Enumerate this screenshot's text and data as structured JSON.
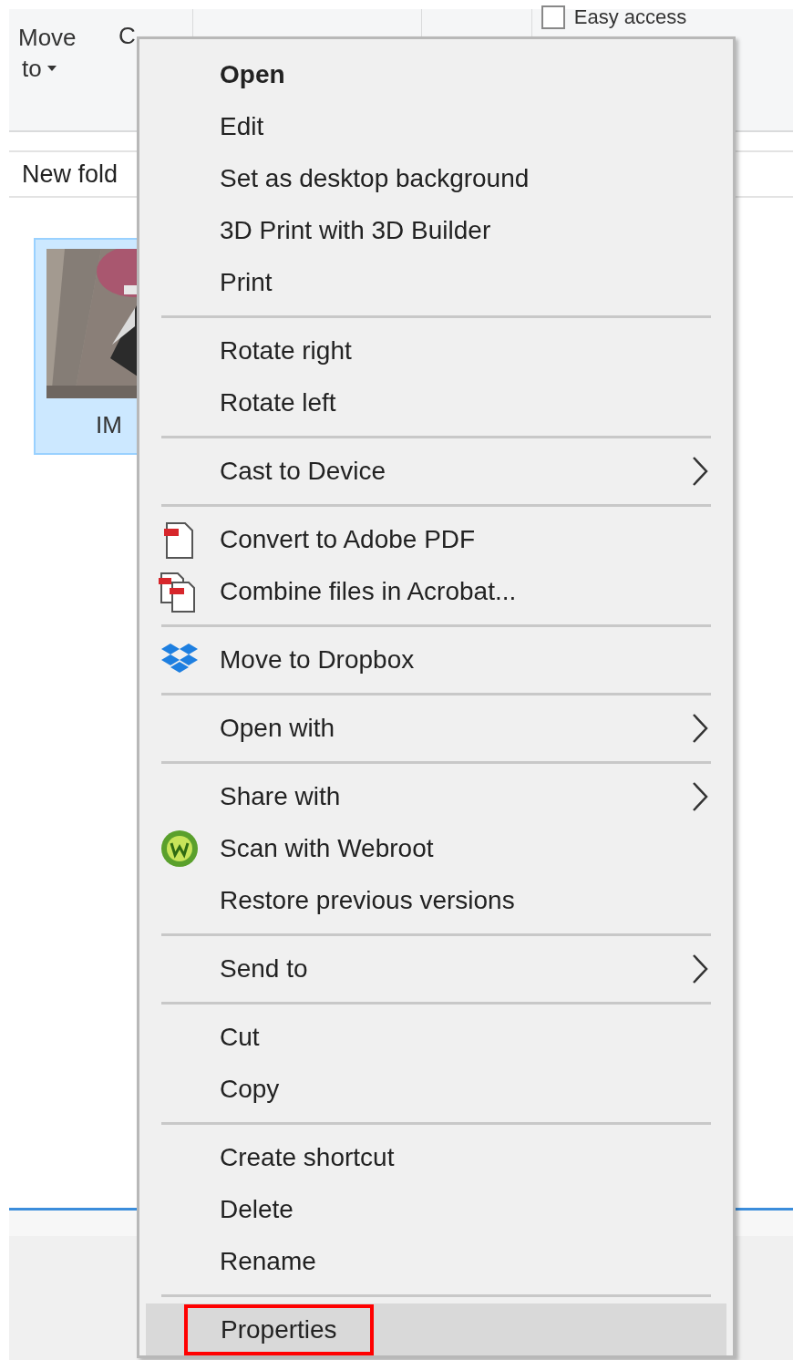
{
  "ribbon": {
    "move_to": {
      "line1": "Move",
      "line2": "to",
      "dropdown": true
    },
    "copy": "C",
    "easy_access": {
      "label": "Easy access",
      "checked": false
    }
  },
  "address_bar": {
    "text": "New fold"
  },
  "file": {
    "name": "IM",
    "selected": true
  },
  "context_menu": {
    "groups": [
      [
        {
          "label": "Open",
          "bold": true,
          "submenu": false,
          "selected": false
        },
        {
          "label": "Edit",
          "bold": false,
          "submenu": false,
          "selected": false
        },
        {
          "label": "Set as desktop background",
          "bold": false,
          "submenu": false,
          "selected": false
        },
        {
          "label": "3D Print with 3D Builder",
          "bold": false,
          "submenu": false,
          "selected": false
        },
        {
          "label": "Print",
          "bold": false,
          "submenu": false,
          "selected": false
        }
      ],
      [
        {
          "label": "Rotate right",
          "bold": false,
          "submenu": false,
          "selected": false
        },
        {
          "label": "Rotate left",
          "bold": false,
          "submenu": false,
          "selected": false
        }
      ],
      [
        {
          "label": "Cast to Device",
          "bold": false,
          "submenu": true,
          "selected": false
        }
      ],
      [
        {
          "label": "Convert to Adobe PDF",
          "bold": false,
          "submenu": false,
          "kind": "pdf",
          "selected": false
        },
        {
          "label": "Combine files in Acrobat...",
          "bold": false,
          "submenu": false,
          "kind": "acrobat",
          "selected": false
        }
      ],
      [
        {
          "label": "Move to Dropbox",
          "bold": false,
          "submenu": false,
          "kind": "dropbox",
          "selected": false
        }
      ],
      [
        {
          "label": "Open with",
          "bold": false,
          "submenu": true,
          "selected": false
        }
      ],
      [
        {
          "label": "Share with",
          "bold": false,
          "submenu": true,
          "selected": false
        },
        {
          "label": "Scan with Webroot",
          "bold": false,
          "submenu": false,
          "kind": "webroot",
          "selected": false
        },
        {
          "label": "Restore previous versions",
          "bold": false,
          "submenu": false,
          "selected": false
        }
      ],
      [
        {
          "label": "Send to",
          "bold": false,
          "submenu": true,
          "selected": false
        }
      ],
      [
        {
          "label": "Cut",
          "bold": false,
          "submenu": false,
          "selected": false
        },
        {
          "label": "Copy",
          "bold": false,
          "submenu": false,
          "selected": false
        }
      ],
      [
        {
          "label": "Create shortcut",
          "bold": false,
          "submenu": false,
          "selected": false
        },
        {
          "label": "Delete",
          "bold": false,
          "submenu": false,
          "selected": false
        },
        {
          "label": "Rename",
          "bold": false,
          "submenu": false,
          "selected": false
        }
      ],
      [
        {
          "label": "Properties",
          "bold": false,
          "submenu": false,
          "selected": true,
          "annotated": true
        }
      ]
    ]
  }
}
